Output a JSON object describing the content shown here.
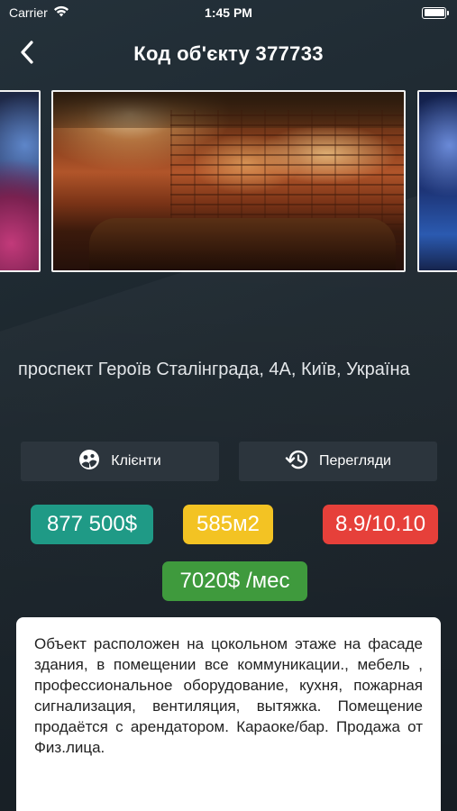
{
  "status_bar": {
    "carrier": "Carrier",
    "time": "1:45 PM",
    "wifi_icon": "wifi-icon",
    "battery_icon": "battery-icon"
  },
  "nav": {
    "title": "Код об'єкту 377733",
    "back_icon": "chevron-left-icon"
  },
  "gallery": {
    "photos": [
      "nightclub-interior",
      "karaoke-bar-brick-wall-lounge",
      "club-interior-blue"
    ]
  },
  "listing": {
    "address": "проспект Героїв Сталінграда, 4А, Київ, Україна"
  },
  "actions": {
    "clients": {
      "label": "Клієнти",
      "icon": "clients-icon"
    },
    "views": {
      "label": "Перегляди",
      "icon": "history-icon"
    }
  },
  "badges": {
    "price": {
      "text": "877 500$",
      "color": "#1f9a86"
    },
    "area": {
      "text": "585м2",
      "color": "#f3c323"
    },
    "rating": {
      "text": "8.9/10.10",
      "color": "#e6403a"
    },
    "rent": {
      "text": "7020$ /мес",
      "color": "#3f9a3d"
    }
  },
  "description": {
    "text": "Объект расположен на цокольном этаже на фасаде здания, в помещении все коммуникации., мебель , профессиональное оборудование, кухня, пожарная сигнализация, вентиляция, вытяжка. Помещение продаётся с арендатором. Караоке/бар. Продажа от Физ.лица."
  }
}
